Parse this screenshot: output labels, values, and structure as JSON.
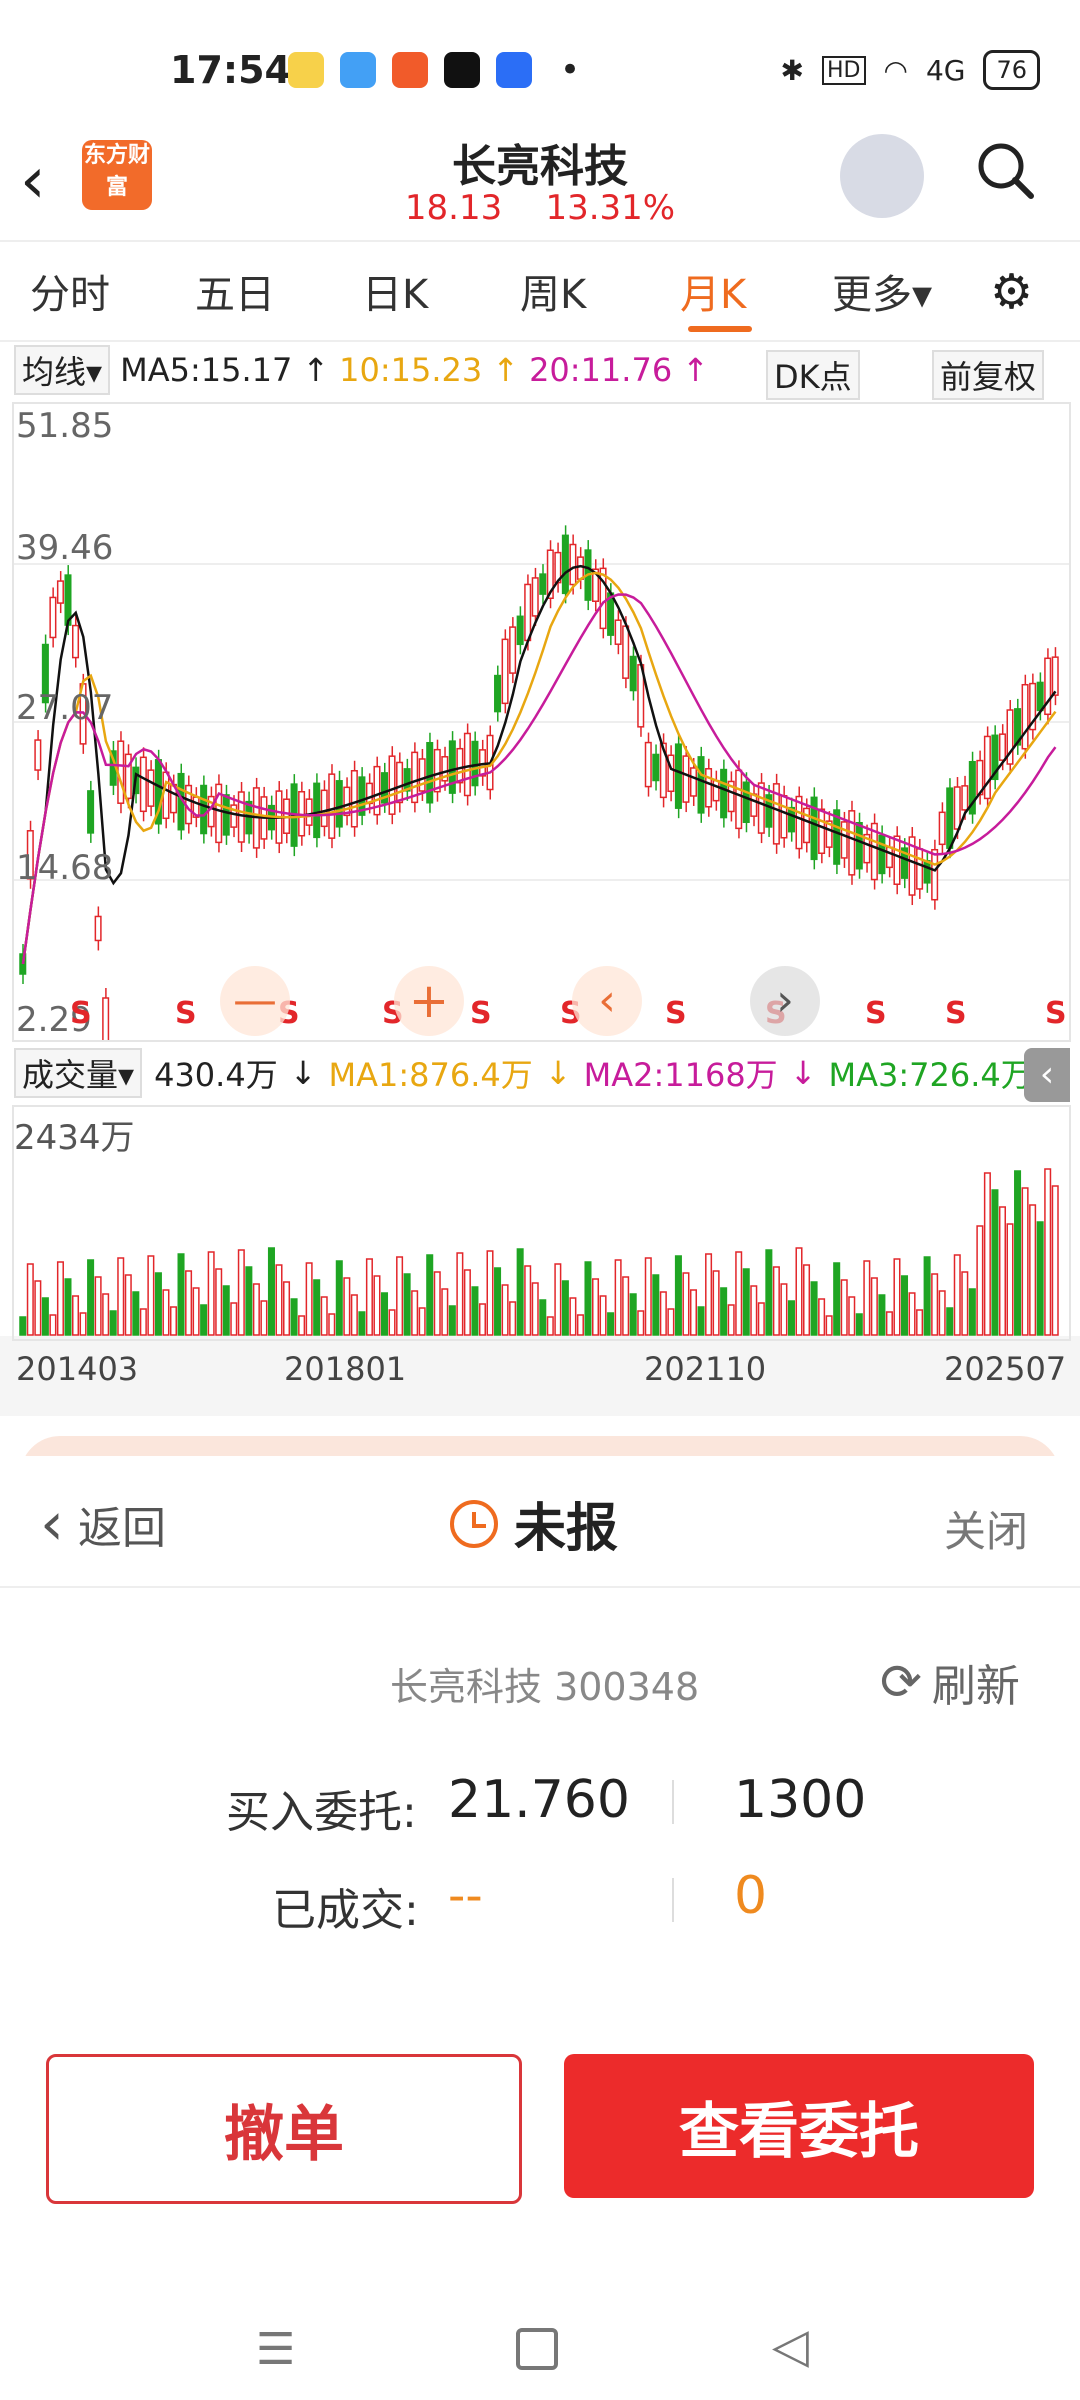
{
  "status_bar": {
    "time": "17:54",
    "battery": "76",
    "signal": "4G"
  },
  "header": {
    "logo_text": "东方财富",
    "title": "长亮科技",
    "price": "18.13",
    "change_pct": "13.31%"
  },
  "tabs": [
    "分时",
    "五日",
    "日K",
    "周K",
    "月K",
    "更多▾"
  ],
  "active_tab": "月K",
  "ma_bar": {
    "selector": "均线▾",
    "ma5": "MA5:15.17",
    "ma10": "10:15.23",
    "ma20": "20:11.76",
    "dk": "DK点",
    "adjust": "前复权"
  },
  "price_axis": [
    "51.85",
    "39.46",
    "27.07",
    "14.68",
    "2.29"
  ],
  "signal_marks": [
    "S",
    "S",
    "S",
    "S",
    "S",
    "S",
    "S",
    "S",
    "S",
    "S",
    "S"
  ],
  "volume_bar": {
    "selector": "成交量▾",
    "volume": "430.4万",
    "ma1": "MA1:876.4万",
    "ma2": "MA2:1168万",
    "ma3": "MA3:726.4万",
    "max": "2434万"
  },
  "dates": [
    "201403",
    "201801",
    "202110",
    "202507"
  ],
  "panel": {
    "back": "返回",
    "status": "未报",
    "close": "关闭",
    "stock": "长亮科技 300348",
    "refresh": "刷新",
    "buy_label": "买入委托:",
    "buy_price": "21.760",
    "buy_qty": "1300",
    "filled_label": "已成交:",
    "filled_price": "--",
    "filled_qty": "0",
    "cancel_button": "撤单",
    "view_button": "查看委托"
  },
  "colors": {
    "up": "#e2262a",
    "down": "#1fa523",
    "accent": "#ef6b1f"
  }
}
